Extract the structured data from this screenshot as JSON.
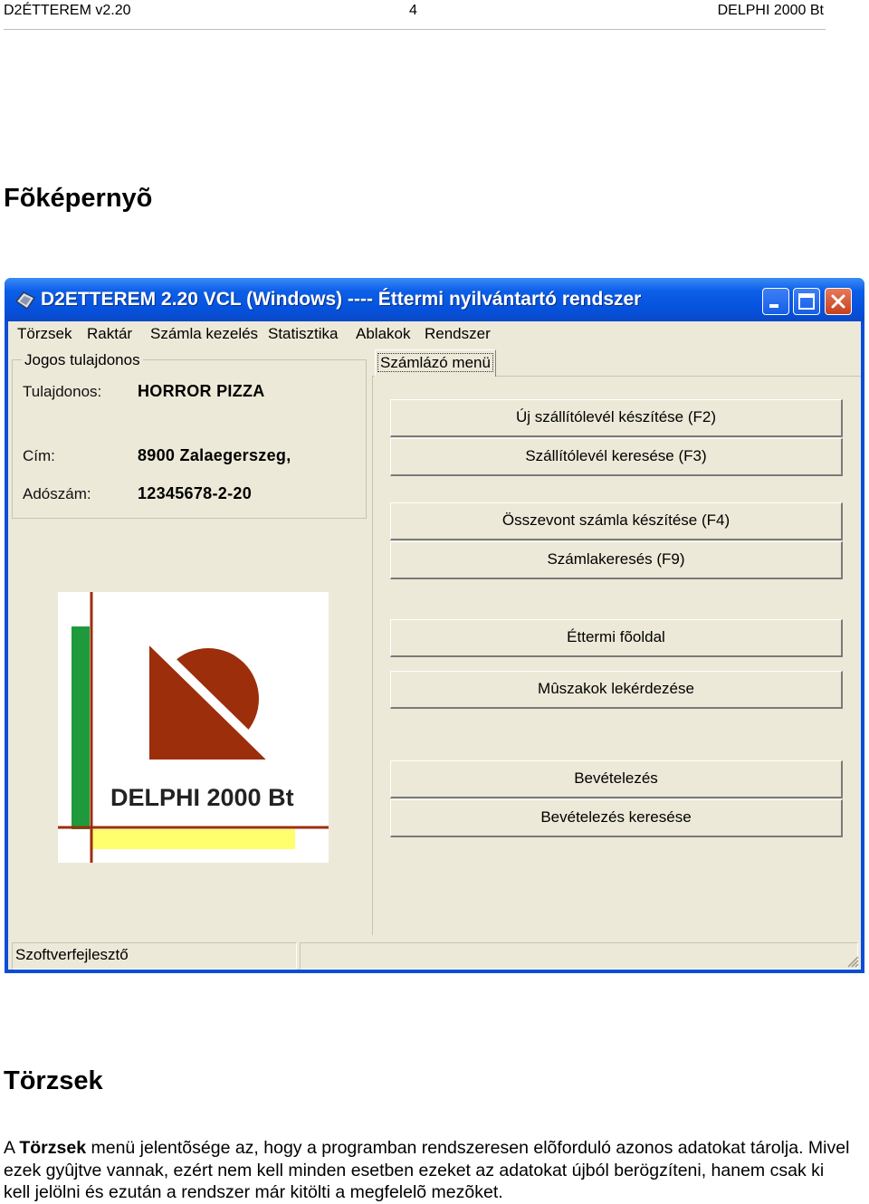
{
  "header": {
    "left": "D2ÉTTEREM v2.20",
    "center": "4",
    "right": "DELPHI 2000 Bt"
  },
  "heading_main": "Fõképernyõ",
  "window": {
    "title": "D2ETTEREM 2.20 VCL (Windows)  ----  Éttermi nyilvántartó rendszer",
    "menu": [
      "Törzsek",
      "Raktár",
      "Számla kezelés",
      "Statisztika",
      "Ablakok",
      "Rendszer"
    ],
    "owner": {
      "legend": "Jogos tulajdonos",
      "owner_label": "Tulajdonos:",
      "owner_value": "HORROR PIZZA",
      "address_label": "Cím:",
      "address_value": "8900 Zalaegerszeg,",
      "tax_label": "Adószám:",
      "tax_value": "12345678-2-20"
    },
    "tab_label": "Számlázó menü",
    "buttons": [
      "Új szállítólevél készítése (F2)",
      "Szállítólevél keresése (F3)",
      "Összevont számla készítése (F4)",
      "Számlakeresés (F9)",
      "Éttermi fõoldal",
      "Mûszakok lekérdezése",
      "Bevételezés",
      "Bevételezés keresése"
    ],
    "logo_text": "DELPHI 2000 Bt",
    "status": "Szoftverfejlesztő"
  },
  "heading_torzsek": "Törzsek",
  "body": {
    "prefix": "A ",
    "bold": "Törzsek",
    "rest": " menü jelentõsége az, hogy a programban rendszeresen elõforduló azonos adatokat tárolja. Mivel ezek gyûjtve vannak, ezért nem kell minden esetben ezeket az adatokat újból berögzíteni, hanem csak ki kell jelölni és ezután a rendszer már kitölti a megfelelõ mezõket."
  },
  "colors": {
    "titlebar": "#0552dd",
    "client": "#ece9d8",
    "logo_brown": "#9c2e0c",
    "logo_green": "#1e9a3c",
    "logo_yellow": "#ffff6e"
  }
}
